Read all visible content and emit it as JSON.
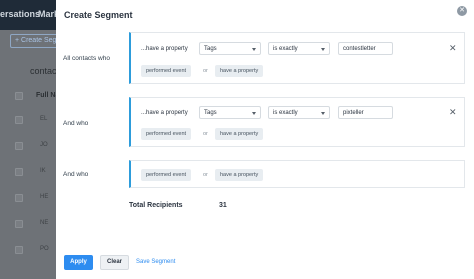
{
  "background": {
    "nav": [
      "ersations",
      "Mark"
    ],
    "create_button": "+ Create Seg",
    "contacts_title": "contacts",
    "column_header": "Full Na",
    "rows": [
      "EL",
      "JO",
      "IK",
      "HE",
      "NE",
      "PO"
    ]
  },
  "modal": {
    "title": "Create Segment",
    "blocks": [
      {
        "label": "All contacts who",
        "condition": "...have a property",
        "property": "Tags",
        "operator": "is exactly",
        "value": "contestletter",
        "chips": [
          "performed event",
          "have a property"
        ],
        "or": "or"
      },
      {
        "label": "And who",
        "condition": "...have a property",
        "property": "Tags",
        "operator": "is exactly",
        "value": "pixteller",
        "chips": [
          "performed event",
          "have a property"
        ],
        "or": "or"
      },
      {
        "label": "And who",
        "chips": [
          "performed event",
          "have a property"
        ],
        "or": "or"
      }
    ],
    "total_label": "Total Recipients",
    "total_value": "31",
    "apply": "Apply",
    "clear": "Clear",
    "save": "Save Segment"
  },
  "colors": {
    "accent": "#2d8cf0",
    "block_border": "#2d9cdb",
    "topbar": "#1f2b38"
  }
}
